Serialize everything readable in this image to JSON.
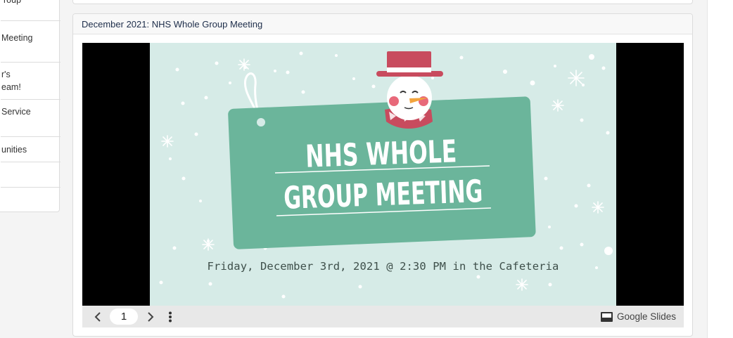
{
  "sidebar": {
    "items": [
      {
        "lines": [
          "roup"
        ]
      },
      {
        "lines": [
          "Meeting"
        ]
      },
      {
        "lines": [
          "r's",
          "eam!"
        ]
      },
      {
        "lines": [
          "Service"
        ]
      },
      {
        "lines": [
          "unities"
        ]
      },
      {
        "lines": [
          ""
        ]
      }
    ]
  },
  "card": {
    "title": "December 2021: NHS Whole Group Meeting"
  },
  "slide": {
    "title_line1": "NHS WHOLE",
    "title_line2": "GROUP MEETING",
    "date_text": "Friday, December 3rd, 2021 @ 2:30 PM in the Cafeteria",
    "colors": {
      "background": "#d6ebe7",
      "panel": "#6bb59b",
      "hat": "#c84b5e",
      "text": "#3e4f4a"
    }
  },
  "toolbar": {
    "prev_icon": "chevron-left-icon",
    "page_number": "1",
    "next_icon": "chevron-right-icon",
    "more_icon": "more-vert-icon",
    "brand_label": "Google Slides"
  }
}
